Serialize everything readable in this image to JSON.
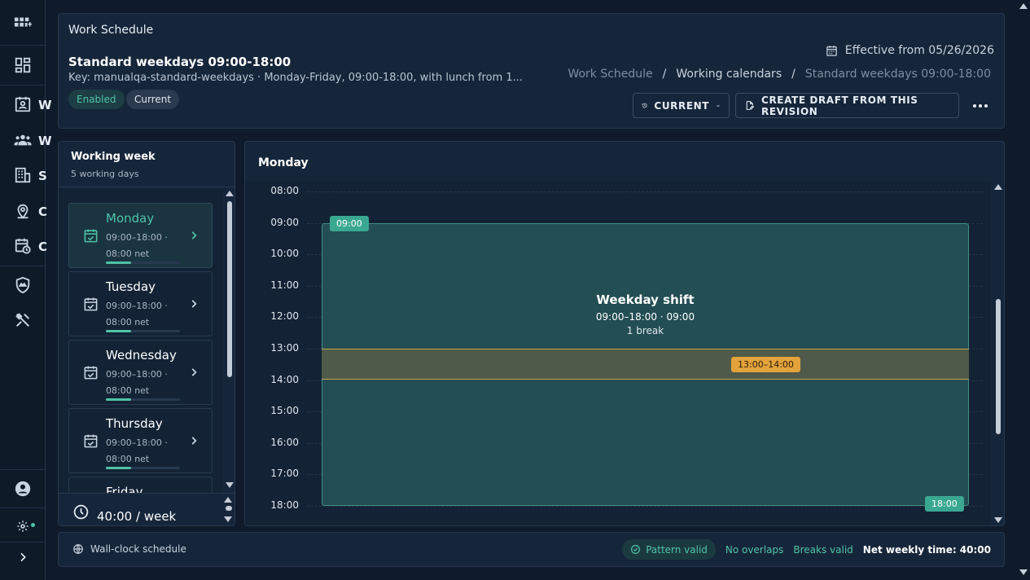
{
  "sidebar": {
    "items": [
      {
        "icon": "apps-grid-plus-icon"
      },
      {
        "icon": "dashboard-icon"
      },
      {
        "icon": "badge-icon",
        "label": "W"
      },
      {
        "icon": "people-icon",
        "label": "W"
      },
      {
        "icon": "building-icon",
        "label": "S"
      },
      {
        "icon": "location-pin-icon",
        "label": "C"
      },
      {
        "icon": "calendar-clock-icon",
        "label": "C"
      },
      {
        "icon": "shield-icon"
      },
      {
        "icon": "tools-icon"
      },
      {
        "icon": "account-icon"
      },
      {
        "icon": "settings-icon"
      },
      {
        "icon": "chevron-right-icon"
      }
    ],
    "status_dot_color": "#4fc3a6"
  },
  "header": {
    "section_title": "Work Schedule",
    "schedule_name": "Standard weekdays 09:00-18:00",
    "key_line": "Key: manualqa-standard-weekdays · Monday-Friday, 09:00-18:00, with lunch from 1...",
    "chip_enabled": "Enabled",
    "chip_current": "Current",
    "effective": "Effective from 05/26/2026",
    "breadcrumb": [
      "Work Schedule",
      "Working calendars",
      "Standard weekdays 09:00-18:00"
    ],
    "breadcrumb_sep": "/",
    "btn_current": "CURRENT",
    "btn_draft": "CREATE DRAFT FROM THIS REVISION"
  },
  "week": {
    "title": "Working week",
    "subtitle": "5 working days",
    "days": [
      {
        "name": "Monday",
        "hours": "09:00–18:00 ·",
        "net": "08:00 net",
        "fill": 0.34,
        "active": true
      },
      {
        "name": "Tuesday",
        "hours": "09:00–18:00 ·",
        "net": "08:00 net",
        "fill": 0.34,
        "active": false
      },
      {
        "name": "Wednesday",
        "hours": "09:00–18:00 ·",
        "net": "08:00 net",
        "fill": 0.34,
        "active": false
      },
      {
        "name": "Thursday",
        "hours": "09:00–18:00 ·",
        "net": "08:00 net",
        "fill": 0.34,
        "active": false
      },
      {
        "name": "Friday",
        "hours": "",
        "net": "",
        "fill": 0.34,
        "active": false
      }
    ],
    "total": "40:00 / week"
  },
  "day_view": {
    "title": "Monday",
    "hours": [
      "08:00",
      "09:00",
      "10:00",
      "11:00",
      "12:00",
      "13:00",
      "14:00",
      "15:00",
      "16:00",
      "17:00",
      "18:00"
    ],
    "shift_title": "Weekday shift",
    "shift_time": "09:00–18:00 · 09:00",
    "shift_breaks": "1 break",
    "start_tag": "09:00",
    "end_tag": "18:00",
    "break_tag": "13:00–14:00",
    "colors": {
      "shift": "#234e53",
      "break": "#4f5a4a",
      "accent": "#3aa891",
      "break_tag": "#e3a23c"
    }
  },
  "footer": {
    "mode": "Wall-clock schedule",
    "pattern_valid": "Pattern valid",
    "no_overlaps": "No overlaps",
    "breaks_valid": "Breaks valid",
    "net_weekly": "Net weekly time: 40:00"
  }
}
